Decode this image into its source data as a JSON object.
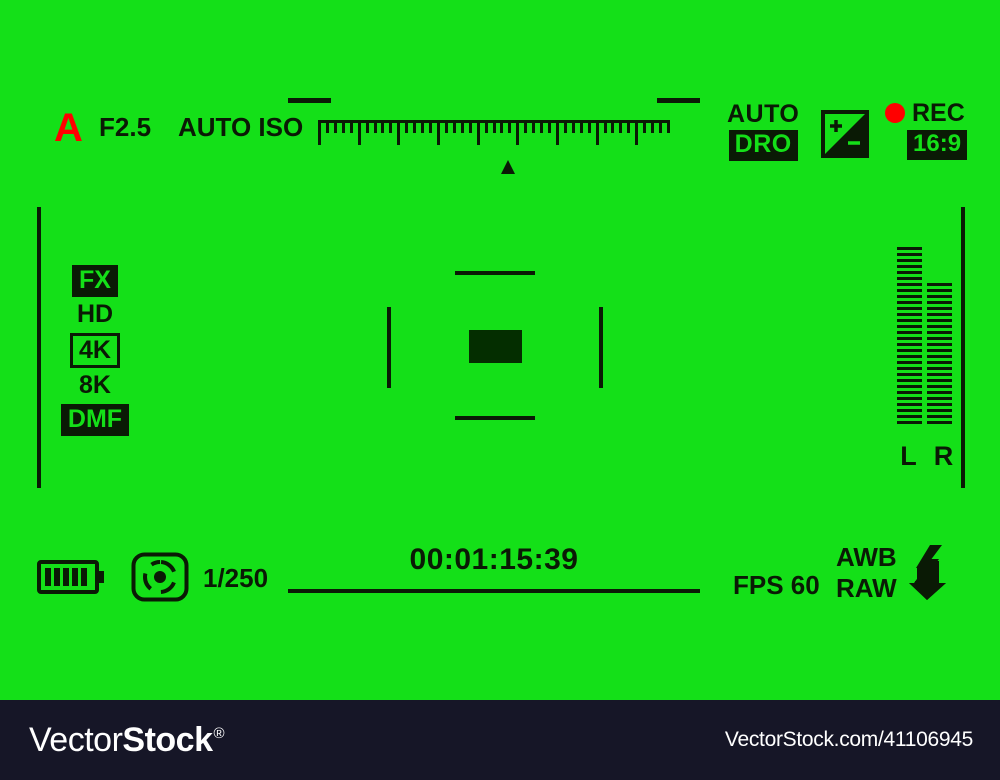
{
  "viewfinder": {
    "background_color": "#14e018",
    "ink_color": "#0a1a05",
    "accent_red": "#ff0000",
    "top_bar": {
      "mode_letter": "A",
      "aperture": "F2.5",
      "iso": "AUTO ISO",
      "dro_auto_label": "AUTO",
      "dro_badge": "DRO",
      "ev_icon": "exposure-compensation-icon",
      "ev_plus": "+",
      "ev_minus": "−",
      "rec_label": "REC",
      "rec_dot": "record-dot",
      "aspect_ratio": "16:9"
    },
    "exposure_scale": {
      "total_ticks": 45,
      "major_every": 5,
      "pointer_position_percent": 54
    },
    "resolution_stack": [
      {
        "label": "FX",
        "style": "filled"
      },
      {
        "label": "HD",
        "style": "plain"
      },
      {
        "label": "4K",
        "style": "outlined"
      },
      {
        "label": "8K",
        "style": "plain"
      },
      {
        "label": "DMF",
        "style": "filled"
      }
    ],
    "focus": {
      "icon": "center-focus-brackets",
      "box": "focus-target-box"
    },
    "audio_meters": {
      "left_label": "L",
      "right_label": "R",
      "left_segments": 30,
      "right_segments": 24
    },
    "bottom_bar": {
      "battery_icon": "battery-icon",
      "battery_bars": 5,
      "metering_icon": "metering-mode-icon",
      "shutter_speed": "1/250",
      "timecode": "00:01:15:39",
      "fps": "FPS 60",
      "white_balance": "AWB",
      "file_format": "RAW",
      "flash_icon": "flash-bolt-icon"
    }
  },
  "footer": {
    "brand_light": "Vector",
    "brand_bold": "Stock",
    "brand_registered": "®",
    "url": "VectorStock.com/41106945",
    "background_color": "#161627"
  }
}
